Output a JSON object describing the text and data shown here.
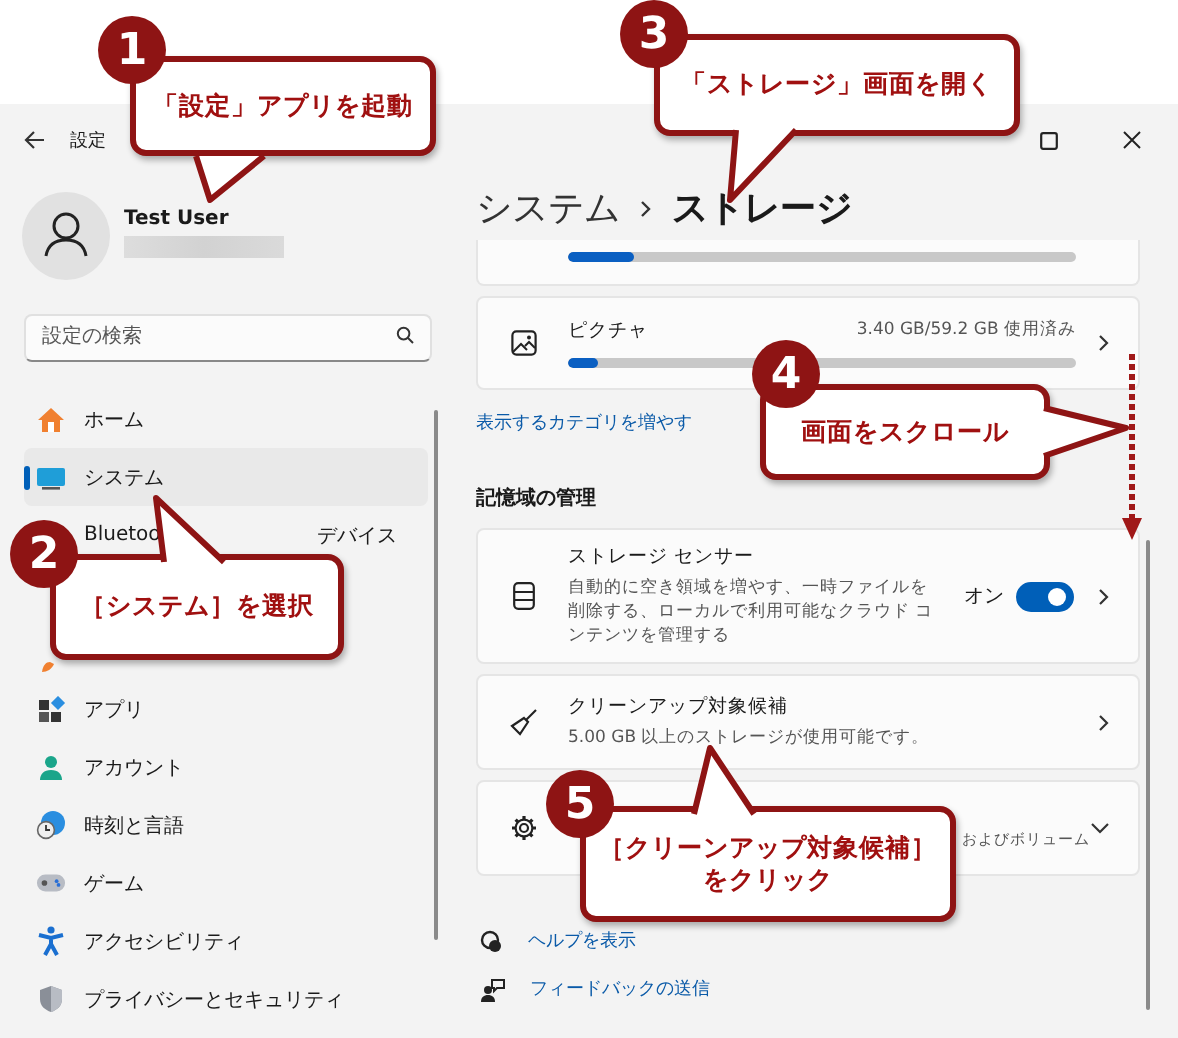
{
  "window": {
    "title": "設定"
  },
  "profile": {
    "name": "Test User"
  },
  "search": {
    "placeholder": "設定の検索"
  },
  "nav_items": [
    {
      "kind": "item",
      "label": "ホーム",
      "selected": false
    },
    {
      "kind": "item",
      "label": "システム",
      "selected": true
    },
    {
      "kind": "item",
      "label_parts": [
        "Bluetoo",
        "デバイス"
      ],
      "selected": false
    },
    {
      "kind": "covered"
    },
    {
      "kind": "covered"
    },
    {
      "kind": "item",
      "label": "アプリ",
      "selected": false
    },
    {
      "kind": "item",
      "label": "アカウント",
      "selected": false
    },
    {
      "kind": "item",
      "label": "時刻と言語",
      "selected": false
    },
    {
      "kind": "item",
      "label": "ゲーム",
      "selected": false
    },
    {
      "kind": "item",
      "label": "アクセシビリティ",
      "selected": false
    },
    {
      "kind": "item",
      "label": "プライバシーとセキュリティ",
      "selected": false
    }
  ],
  "breadcrumb": {
    "parent": "システム",
    "current": "ストレージ"
  },
  "storage_top": {
    "level": 0.13
  },
  "storage_category": {
    "name": "ピクチャ",
    "usage": "3.40 GB/59.2 GB 使用済み",
    "level": 0.06
  },
  "more_categories_link": "表示するカテゴリを増やす",
  "section_title": "記憶域の管理",
  "cards": [
    {
      "kind": "toggle",
      "title": "ストレージ センサー",
      "description": "自動的に空き領域を増やす、一時ファイルを削除する、ローカルで利用可能なクラウド コンテンツを管理する",
      "toggle_label": "オン",
      "on": true
    },
    {
      "kind": "link",
      "title": "クリーンアップ対象候補",
      "description": "5.00 GB 以上のストレージが使用可能です。"
    },
    {
      "kind": "expander",
      "description": "およびボリューム",
      "expanded": false
    }
  ],
  "footer_links": [
    "ヘルプを表示",
    "フィードバックの送信"
  ],
  "callouts": [
    {
      "number": "1",
      "text": "「設定」アプリを起動"
    },
    {
      "number": "2",
      "text": "［システム］を選択"
    },
    {
      "number": "3",
      "text": "「ストレージ」画面を開く"
    },
    {
      "number": "4",
      "text": "画面をスクロール"
    },
    {
      "number": "5",
      "text_lines": [
        "［クリーンアップ対象候補］",
        "をクリック"
      ]
    }
  ]
}
